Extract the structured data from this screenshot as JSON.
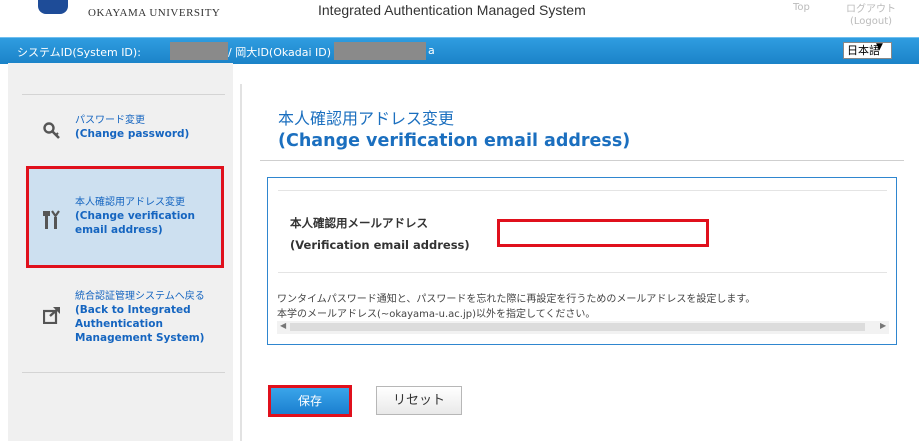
{
  "header": {
    "university": "OKAYAMA UNIVERSITY",
    "system_title": "Integrated Authentication Managed System",
    "top_link": "Top",
    "logout_jp": "ログアウト",
    "logout_en": "(Logout)"
  },
  "id_bar": {
    "system_id_label": "システムID(System ID):",
    "okadai_id_label": "/ 岡大ID(Okadai ID)",
    "okadai_id_suffix": "a",
    "language": "日本語"
  },
  "sidebar": {
    "items": [
      {
        "label_jp": "パスワード変更",
        "label_en": "(Change password)",
        "icon": "key-icon"
      },
      {
        "label_jp": "本人確認用アドレス変更",
        "label_en": "(Change verification email address)",
        "icon": "tools-icon"
      },
      {
        "label_jp": "統合認証管理システムへ戻る",
        "label_en": "(Back to Integrated Authentication Management System)",
        "icon": "external-link-icon"
      }
    ]
  },
  "main": {
    "title_jp": "本人確認用アドレス変更",
    "title_en": "(Change verification email address)",
    "field_label_jp": "本人確認用メールアドレス",
    "field_label_en": "(Verification email address)",
    "email_value": "",
    "description_1": "ワンタイムパスワード通知と、パスワードを忘れた際に再設定を行うためのメールアドレスを設定します。",
    "description_2": "本学のメールアドレス(~okayama-u.ac.jp)以外を指定してください。",
    "save_label": "保存",
    "reset_label": "リセット"
  },
  "colors": {
    "accent_blue": "#1b83c8",
    "link_blue": "#1565c0",
    "highlight_red": "#e0101c",
    "selected_bg": "#cde0f0"
  }
}
